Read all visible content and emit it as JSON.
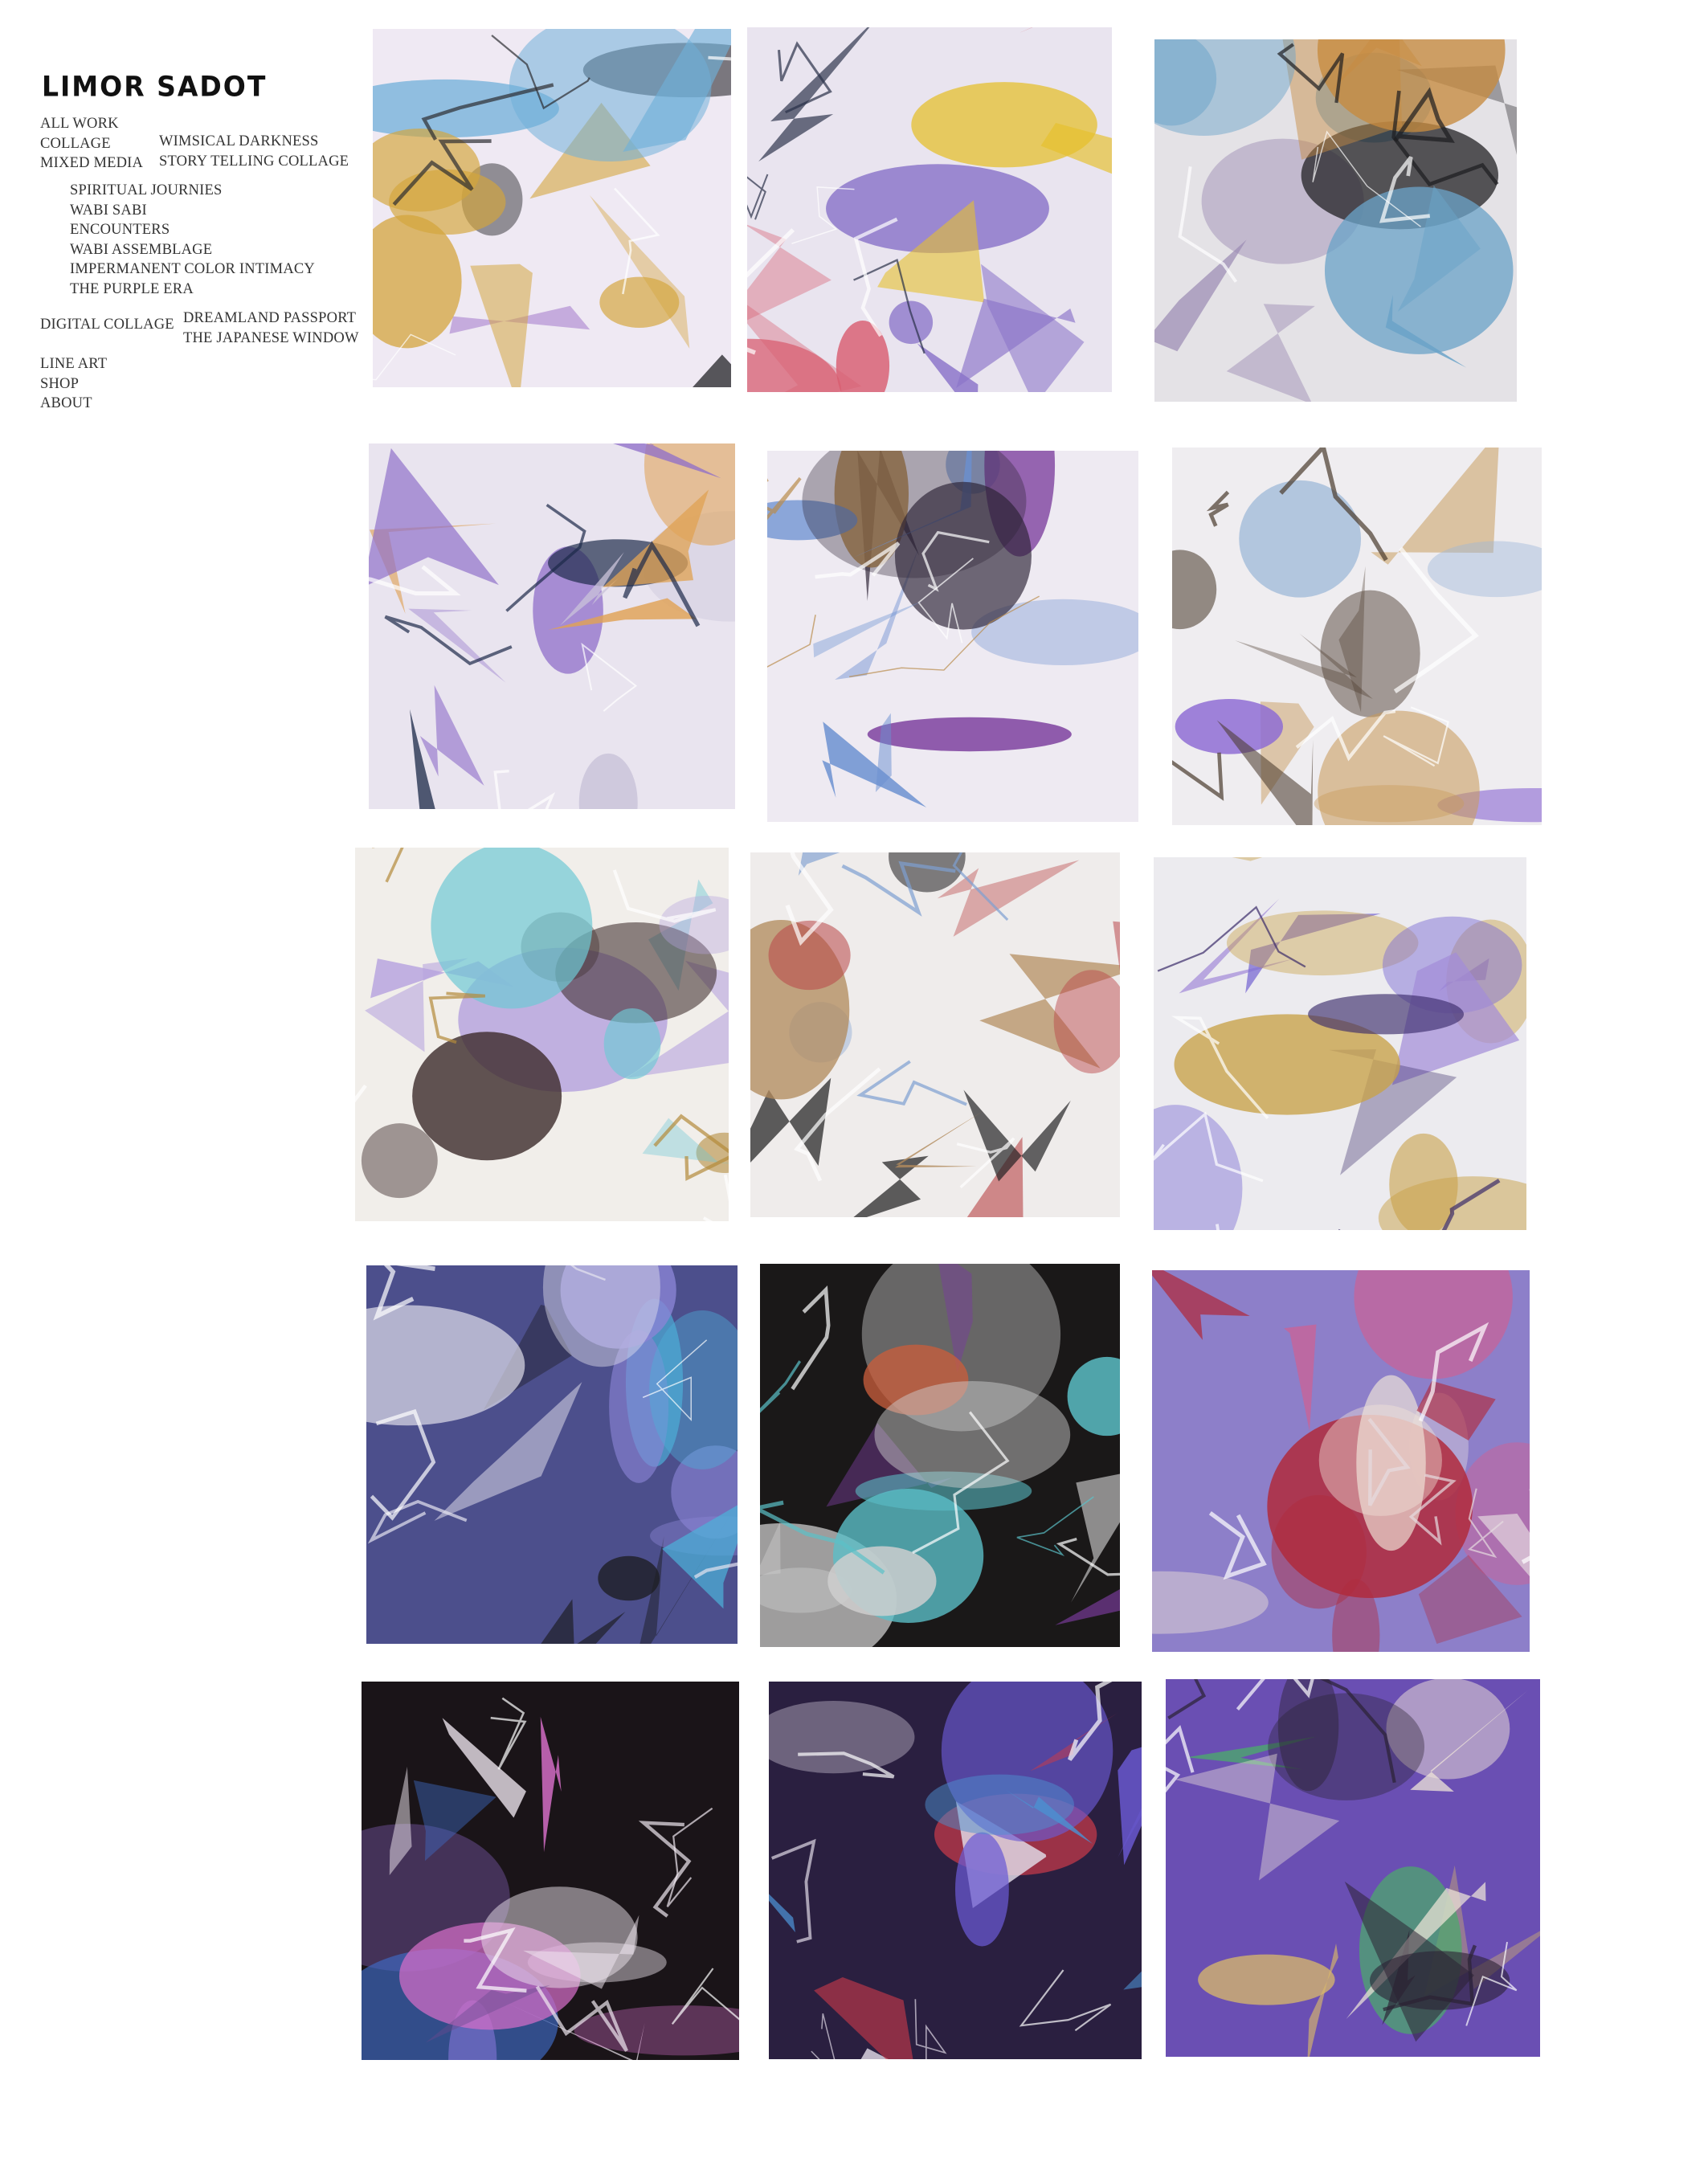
{
  "site": {
    "title": "LIMOR SADOT"
  },
  "nav": {
    "main_top": [
      "ALL WORK",
      "COLLAGE",
      "MIXED MEDIA"
    ],
    "collage_sub": [
      "WIMSICAL DARKNESS",
      "STORY TELLING COLLAGE"
    ],
    "mixed_media_sub": [
      "SPIRITUAL JOURNIES",
      "WABI SABI",
      "ENCOUNTERS",
      "WABI ASSEMBLAGE",
      "IMPERMANENT COLOR  INTIMACY",
      "THE PURPLE ERA"
    ],
    "digital": "DIGITAL COLLAGE",
    "digital_sub": [
      "DREAMLAND PASSPORT",
      "THE JAPANESE WINDOW"
    ],
    "main_bottom": [
      "LINE ART",
      "SHOP",
      "ABOUT"
    ]
  },
  "gallery": {
    "artworks": [
      {
        "id": "a1",
        "palette": [
          "#efe9f3",
          "#b99ad6",
          "#2c2c30",
          "#d4a53c",
          "#6fb0d9"
        ]
      },
      {
        "id": "a2",
        "palette": [
          "#e9e4ef",
          "#8a74c9",
          "#2a3148",
          "#e5c02c",
          "#d85f72"
        ]
      },
      {
        "id": "a3",
        "palette": [
          "#e4e2e6",
          "#9b8ab3",
          "#1d1d1f",
          "#c68b3f",
          "#6ba3c8"
        ]
      },
      {
        "id": "a4",
        "palette": [
          "#e9e4ef",
          "#8f6fc9",
          "#1d2a4a",
          "#e0a255",
          "#c9c3d9"
        ]
      },
      {
        "id": "a5",
        "palette": [
          "#eeeaf2",
          "#7c3f9e",
          "#b98b4c",
          "#6a8fd0",
          "#2b2233"
        ]
      },
      {
        "id": "a6",
        "palette": [
          "#efedf0",
          "#8d6bd4",
          "#4a3a2c",
          "#c89a5a",
          "#9cb7d8"
        ]
      },
      {
        "id": "a7",
        "palette": [
          "#f1eeea",
          "#3c2a2a",
          "#b48a3a",
          "#b7a4de",
          "#6fc9d4"
        ]
      },
      {
        "id": "a8",
        "palette": [
          "#efeceb",
          "#b9474a",
          "#7ea0d1",
          "#1d1d1f",
          "#b18a5c"
        ]
      },
      {
        "id": "a9",
        "palette": [
          "#ecebef",
          "#a38bd8",
          "#3a2b6a",
          "#c9a24a",
          "#7f6fd4"
        ]
      },
      {
        "id": "a10",
        "palette": [
          "#4c4f8c",
          "#8a83d4",
          "#e6e4ef",
          "#1d1d23",
          "#4cb0d8"
        ]
      },
      {
        "id": "a11",
        "palette": [
          "#1a1818",
          "#cfcfcf",
          "#5bc0c8",
          "#c85e3c",
          "#7a3c9c"
        ]
      },
      {
        "id": "a12",
        "palette": [
          "#8d7fc9",
          "#b02a3c",
          "#e6dbe0",
          "#d85c8c",
          "#f0e4d8"
        ]
      },
      {
        "id": "a13",
        "palette": [
          "#1a1418",
          "#d46ec7",
          "#efe7ef",
          "#6a4b8f",
          "#3f6ac4"
        ]
      },
      {
        "id": "a14",
        "palette": [
          "#2a1f40",
          "#6b5ad4",
          "#e0d9e6",
          "#c83a4a",
          "#4c8fd0"
        ]
      },
      {
        "id": "a15",
        "palette": [
          "#6a4fb3",
          "#efe4d8",
          "#2b2233",
          "#d9b86a",
          "#4bab6a"
        ]
      }
    ]
  }
}
